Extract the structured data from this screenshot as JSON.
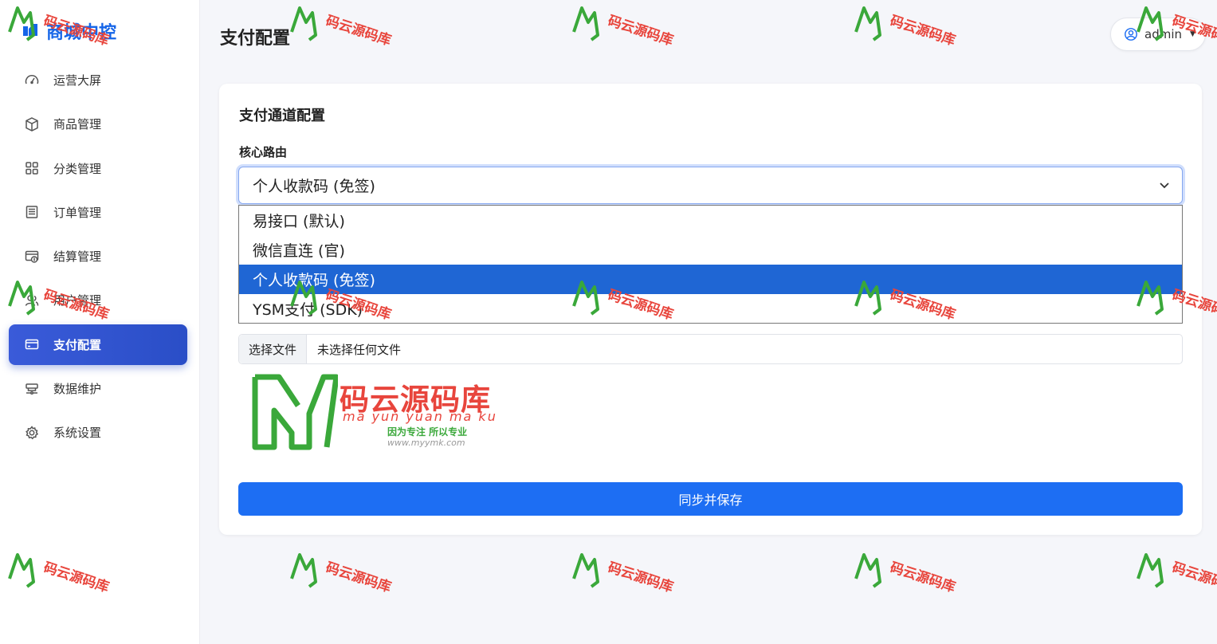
{
  "brand": {
    "title": "商城中控",
    "color": "#1565e8"
  },
  "sidebar": {
    "items": [
      {
        "label": "运营大屏",
        "icon": "dashboard-gauge-icon"
      },
      {
        "label": "商品管理",
        "icon": "box-icon"
      },
      {
        "label": "分类管理",
        "icon": "grid-icon"
      },
      {
        "label": "订单管理",
        "icon": "receipt-icon"
      },
      {
        "label": "结算管理",
        "icon": "settlement-icon"
      },
      {
        "label": "用户管理",
        "icon": "users-icon"
      },
      {
        "label": "支付配置",
        "icon": "credit-card-icon",
        "active": true
      },
      {
        "label": "数据维护",
        "icon": "server-icon"
      },
      {
        "label": "系统设置",
        "icon": "gear-icon"
      }
    ]
  },
  "header": {
    "title": "支付配置",
    "user": {
      "name": "admin",
      "icon": "user-circle-icon"
    }
  },
  "card": {
    "title": "支付通道配置",
    "route_label": "核心路由",
    "route_select": {
      "value": "个人收款码 (免签)",
      "options": [
        "易接口 (默认)",
        "微信直连 (官)",
        "个人收款码 (免签)",
        "YSM支付 (SDK)"
      ],
      "selected_index": 2
    },
    "file": {
      "button_label": "选择文件",
      "status": "未选择任何文件"
    },
    "save_label": "同步并保存"
  },
  "watermark": {
    "title": "码云源码库",
    "subtitle": "ma yun yuan ma ku",
    "slogan": "因为专注 所以专业",
    "url": "www.myymk.com"
  },
  "colors": {
    "accent": "#1d6ef3",
    "active_nav": "#2a4ec7",
    "selected_option": "#1f66d4",
    "watermark_red": "#e8453c",
    "watermark_green": "#3aa83a"
  }
}
